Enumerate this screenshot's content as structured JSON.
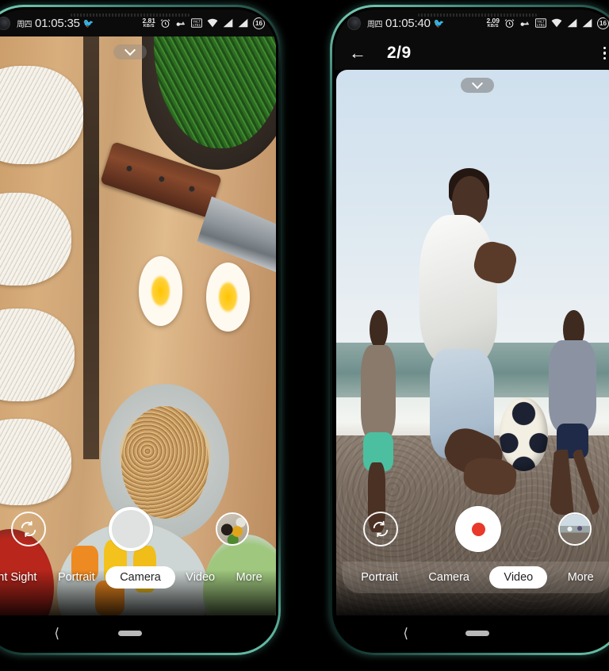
{
  "phones": [
    {
      "id": "left",
      "statusbar": {
        "day": "周四",
        "time": "01:05:35",
        "bird_icon": "bird-icon",
        "net_speed_value": "2.81",
        "net_speed_unit": "KB/S",
        "alarm_icon": "alarm-icon",
        "key_icon": "key-icon",
        "volte_icon": "volte-icon",
        "wifi_icon": "wifi-icon",
        "signal1_icon": "signal-bars-icon",
        "signal2_icon": "signal-bars-icon",
        "battery_level": "16"
      },
      "viewfinder": {
        "expand_icon": "chevron-down-icon",
        "scene": "food-flatlay"
      },
      "controls": {
        "flip_icon": "flip-camera-icon",
        "shutter_label": "shutter-button",
        "thumbnail": "last-photo-thumbnail"
      },
      "modes": [
        {
          "label": "ht Sight",
          "active": false
        },
        {
          "label": "Portrait",
          "active": false
        },
        {
          "label": "Camera",
          "active": true
        },
        {
          "label": "Video",
          "active": false
        },
        {
          "label": "More",
          "active": false
        }
      ],
      "navbar": {
        "back_icon": "back-chevron-icon",
        "home_icon": "home-pill-icon"
      }
    },
    {
      "id": "right",
      "statusbar": {
        "day": "周四",
        "time": "01:05:40",
        "bird_icon": "bird-icon",
        "net_speed_value": "2.09",
        "net_speed_unit": "KB/S",
        "alarm_icon": "alarm-icon",
        "key_icon": "key-icon",
        "volte_icon": "volte-icon",
        "wifi_icon": "wifi-icon",
        "signal1_icon": "signal-bars-icon",
        "signal2_icon": "signal-bars-icon",
        "battery_level": "16"
      },
      "appbar": {
        "back_icon": "back-arrow-icon",
        "title": "2/9",
        "menu_icon": "overflow-menu-icon"
      },
      "viewfinder": {
        "expand_icon": "chevron-down-icon",
        "scene": "beach-football"
      },
      "controls": {
        "flip_icon": "flip-camera-icon",
        "shutter_label": "record-button",
        "thumbnail": "last-video-thumbnail"
      },
      "modes": [
        {
          "label": "Portrait",
          "active": false
        },
        {
          "label": "Camera",
          "active": false
        },
        {
          "label": "Video",
          "active": true
        },
        {
          "label": "More",
          "active": false
        }
      ],
      "navbar": {
        "back_icon": "back-chevron-icon",
        "home_icon": "home-pill-icon"
      }
    }
  ],
  "colors": {
    "frame_accent": "#6fcfb6",
    "record_red": "#e8392b",
    "active_pill": "#ffffff",
    "statusbar_bg": "#0b0b0b"
  }
}
